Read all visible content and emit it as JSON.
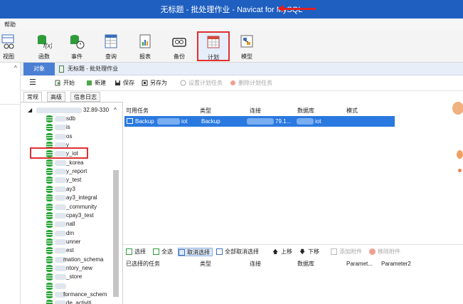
{
  "window": {
    "title": "无标题 - 批处理作业 - Navicat for MySQL"
  },
  "menu": {
    "help": "帮助"
  },
  "toolbar": {
    "view": "视图",
    "function": "函数",
    "event": "事件",
    "query": "查询",
    "report": "报表",
    "backup": "备份",
    "schedule": "计划",
    "model": "模型"
  },
  "objects_tab": "对象",
  "work_tab": "无标题 - 批处理作业",
  "schedule_bar": {
    "start": "开始",
    "new": "新建",
    "save": "保存",
    "save_as": "另存为",
    "set_task": "设置计划任务",
    "delete_task": "删除计划任务"
  },
  "subtabs": {
    "general": "常规",
    "advanced": "高级",
    "log": "信息日志"
  },
  "tree": {
    "root": "32.89-330",
    "items": [
      "sdb",
      "is",
      "os",
      "y",
      "y_iot",
      "_korea",
      "y_report",
      "y_test",
      "ay3",
      "ay3_integral",
      "_community",
      "cpay3_test",
      "nall",
      "dm",
      "unner",
      "est",
      "mation_schema",
      "ntory_new",
      "_store",
      "",
      "formance_schem",
      "de_activiti"
    ]
  },
  "tasks": {
    "headers": {
      "available": "可用任务",
      "type": "类型",
      "connection": "连接",
      "database": "数据库",
      "mode": "模式"
    },
    "row": {
      "name": "Backup",
      "name_tail": "iot",
      "type": "Backup",
      "conn": "79.1...",
      "db": "iot"
    }
  },
  "selection_bar": {
    "select": "选择",
    "select_all": "全选",
    "deselect": "取消选择",
    "deselect_all": "全部取消选择",
    "up": "上移",
    "down": "下移",
    "add_attach": "添加附件",
    "remove_attach": "移除附件"
  },
  "selected": {
    "headers": {
      "selected": "已选择的任务",
      "type": "类型",
      "connection": "连接",
      "database": "数据库",
      "p1": "Paramet...",
      "p2": "Parameter2"
    }
  },
  "colors": {
    "title_bg": "#1e5fc0",
    "accent": "#2a79e0",
    "highlight_red": "#e03030",
    "db_green": "#27a535"
  }
}
